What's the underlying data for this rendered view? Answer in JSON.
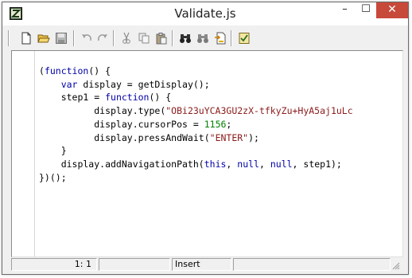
{
  "window": {
    "title": "Validate.js",
    "min_glyph": "–",
    "max_glyph": "☐",
    "close_glyph": "✕"
  },
  "toolbar": {
    "buttons": [
      "new",
      "open",
      "save",
      "undo",
      "redo",
      "cut",
      "copy",
      "paste",
      "find",
      "find-next",
      "replace",
      "validate"
    ]
  },
  "code_lines": [
    [
      {
        "t": "(",
        "c": ""
      },
      {
        "t": "function",
        "c": "kw"
      },
      {
        "t": "() {",
        "c": ""
      }
    ],
    [
      {
        "t": "    ",
        "c": ""
      },
      {
        "t": "var",
        "c": "kw"
      },
      {
        "t": " display = getDisplay();",
        "c": ""
      }
    ],
    [
      {
        "t": "    step1 = ",
        "c": ""
      },
      {
        "t": "function",
        "c": "kw"
      },
      {
        "t": "() {",
        "c": ""
      }
    ],
    [
      {
        "t": "          display.type(",
        "c": ""
      },
      {
        "t": "\"OBi23uYCA3GU2zX-tfkyZu+HyA5aj1uLc",
        "c": "str"
      }
    ],
    [
      {
        "t": "          display.cursorPos = ",
        "c": ""
      },
      {
        "t": "1156",
        "c": "num"
      },
      {
        "t": ";",
        "c": ""
      }
    ],
    [
      {
        "t": "          display.pressAndWait(",
        "c": ""
      },
      {
        "t": "\"ENTER\"",
        "c": "str"
      },
      {
        "t": ");",
        "c": ""
      }
    ],
    [
      {
        "t": "    }",
        "c": ""
      }
    ],
    [
      {
        "t": "    display.addNavigationPath(",
        "c": ""
      },
      {
        "t": "this",
        "c": "kw"
      },
      {
        "t": ", ",
        "c": ""
      },
      {
        "t": "null",
        "c": "kw"
      },
      {
        "t": ", ",
        "c": ""
      },
      {
        "t": "null",
        "c": "kw"
      },
      {
        "t": ", step1);",
        "c": ""
      }
    ],
    [
      {
        "t": "})();",
        "c": ""
      }
    ]
  ],
  "status": {
    "position": "1: 1",
    "mode": "Insert"
  },
  "colors": {
    "keyword": "#0000a8",
    "string": "#8b1a1a",
    "number": "#008000",
    "close": "#c7493a"
  }
}
